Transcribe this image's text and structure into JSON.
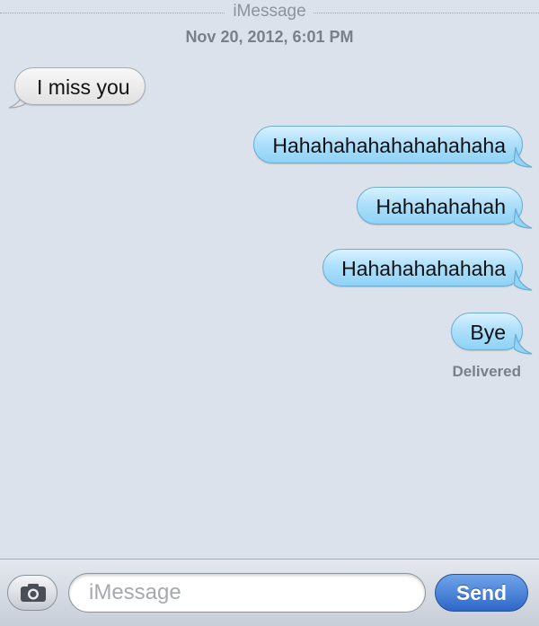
{
  "header": {
    "service": "iMessage",
    "timestamp": "Nov 20, 2012, 6:01 PM"
  },
  "messages": [
    {
      "direction": "received",
      "text": "I miss you"
    },
    {
      "direction": "sent",
      "text": "Hahahahahahahahahaha"
    },
    {
      "direction": "sent",
      "text": "Hahahahahah"
    },
    {
      "direction": "sent",
      "text": "Hahahahahahaha"
    },
    {
      "direction": "sent",
      "text": "Bye"
    }
  ],
  "status": "Delivered",
  "composer": {
    "placeholder": "iMessage",
    "send_label": "Send",
    "camera_icon": "camera-icon"
  },
  "colors": {
    "background": "#dbe2ec",
    "sent_bubble": "#aee0fb",
    "received_bubble": "#ececec",
    "send_button": "#3a74d2"
  }
}
